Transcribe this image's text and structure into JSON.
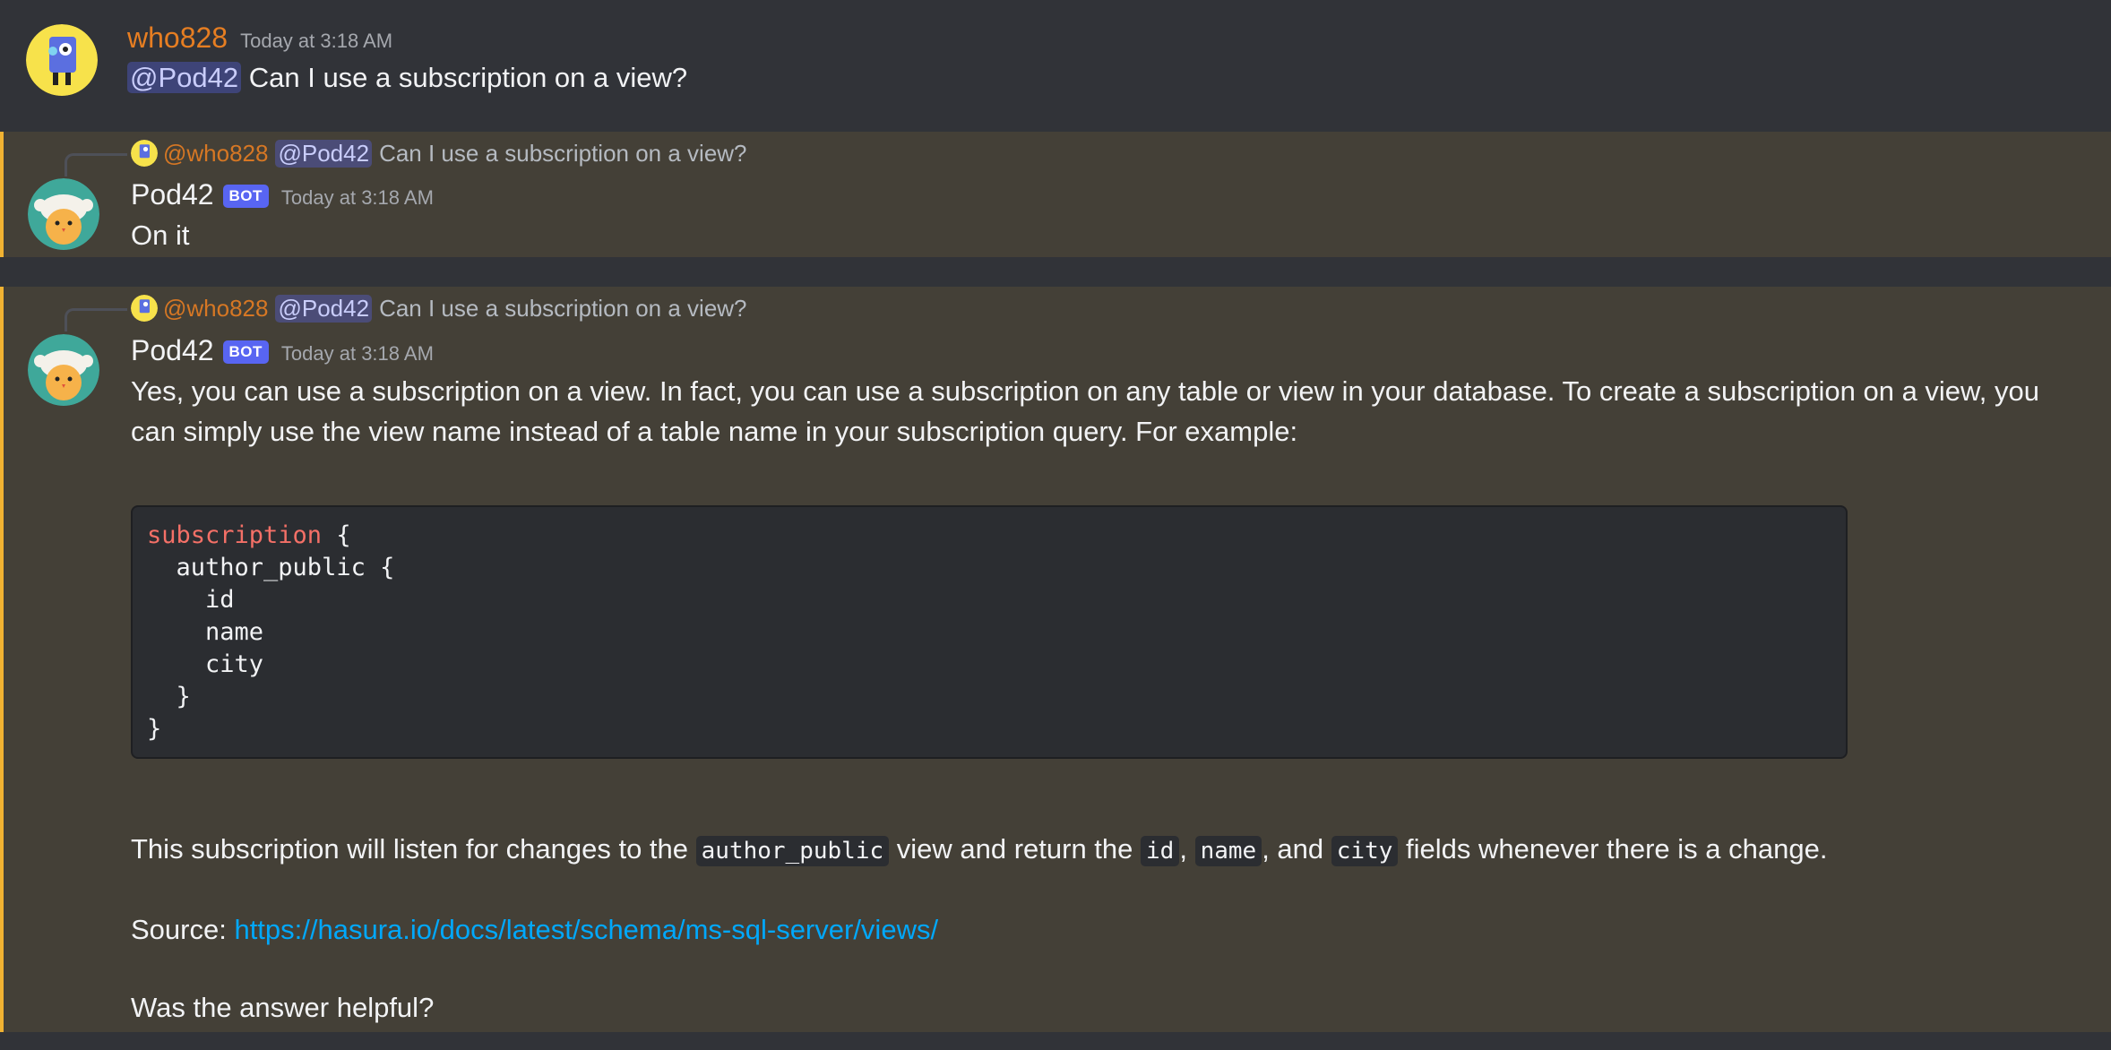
{
  "messages": [
    {
      "username": "who828",
      "timestamp": "Today at 3:18 AM",
      "mention": "@Pod42",
      "text": "Can I use a subscription on a view?"
    },
    {
      "reply": {
        "user": "@who828",
        "mention": "@Pod42",
        "text": "Can I use a subscription on a view?"
      },
      "username": "Pod42",
      "tag": "BOT",
      "timestamp": "Today at 3:18 AM",
      "text": "On it"
    },
    {
      "reply": {
        "user": "@who828",
        "mention": "@Pod42",
        "text": "Can I use a subscription on a view?"
      },
      "username": "Pod42",
      "tag": "BOT",
      "timestamp": "Today at 3:18 AM",
      "intro": "Yes, you can use a subscription on a view. In fact, you can use a subscription on any table or view in your database. To create a subscription on a view, you can simply use the view name instead of a table name in your subscription query. For example:",
      "code": {
        "keyword": "subscription",
        "lines": [
          " {",
          "  author_public {",
          "    id",
          "    name",
          "    city",
          "  }",
          "}"
        ]
      },
      "description": {
        "part1": "This subscription will listen for changes to the ",
        "code1": "author_public",
        "part2": " view and return the ",
        "code2": "id",
        "sep1": ", ",
        "code3": "name",
        "sep2": ", and ",
        "code4": "city",
        "part3": " fields whenever there is a change."
      },
      "source_label": "Source: ",
      "source_url": "https://hasura.io/docs/latest/schema/ms-sql-server/views/",
      "helpful": "Was the answer helpful?"
    }
  ],
  "colors": {
    "background": "#313338",
    "highlight": "#444037",
    "highlight_border": "#f0b232",
    "user_name": "#e67e22",
    "link": "#00a8fc",
    "bot_tag": "#5865f2"
  }
}
